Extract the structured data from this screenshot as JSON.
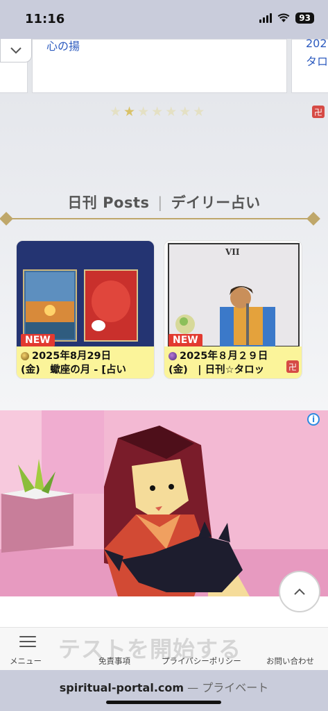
{
  "status_bar": {
    "time": "11:16",
    "battery": "93"
  },
  "top_strip": {
    "link_middle": "心の揚",
    "link_right_top": "202",
    "link_right_bottom": "タロ"
  },
  "rating": {
    "total": 7,
    "filled": 1
  },
  "section": {
    "title_en": "日刊 Posts",
    "separator": "|",
    "title_ja": "デイリー占い"
  },
  "posts": [
    {
      "badge": "NEW",
      "line1": "2025年8月29日",
      "line2": "(金)　蠍座の月 - [占い"
    },
    {
      "badge": "NEW",
      "line1": "2025年８月２９日",
      "line2": "(金)　| 日刊☆タロッ"
    }
  ],
  "bottom_nav": {
    "cta": "テストを開始する",
    "menu": "メニュー",
    "disclaimer": "免責事項",
    "privacy": "プライバシーポリシー",
    "contact": "お問い合わせ"
  },
  "url_bar": {
    "domain": "spiritual-portal.com",
    "mode": " — プライベート"
  },
  "colors": {
    "accent_gold": "#bfa76a",
    "new_badge": "#e23a30",
    "caption_bg": "#fbf49a",
    "ad_bg": "#f3b9d3"
  }
}
